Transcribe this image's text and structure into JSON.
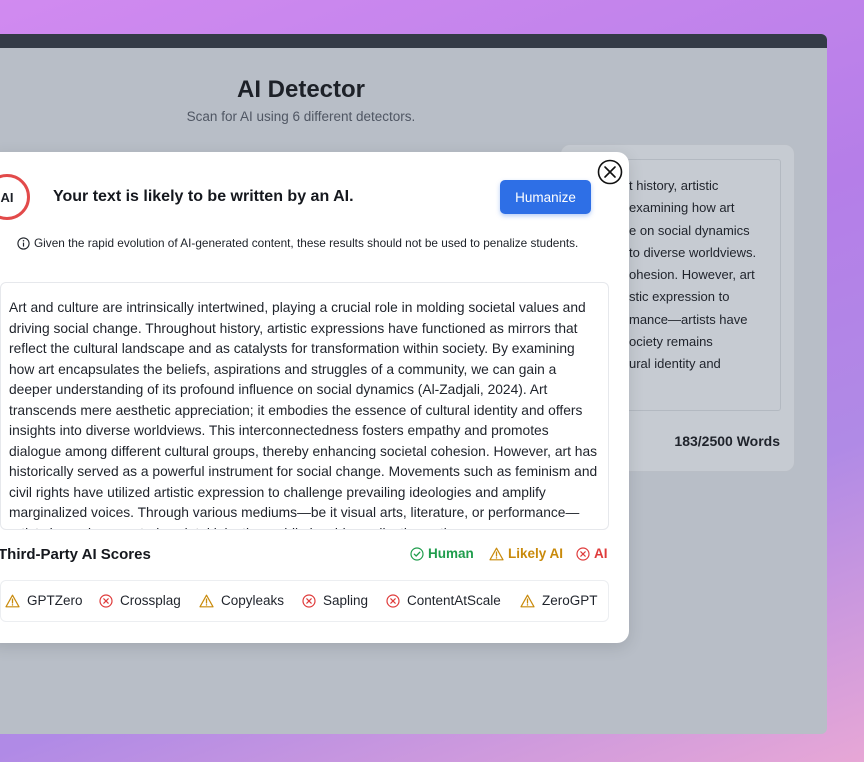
{
  "app": {
    "title": "AI Detector",
    "subtitle": "Scan for AI using 6 different detectors."
  },
  "background_card": {
    "lines": [
      "t history, artistic",
      "examining how art",
      "e on social dynamics",
      "to diverse worldviews.",
      "ohesion. However, art",
      "stic expression to",
      "mance—artists have",
      "ociety remains",
      "ural identity and"
    ],
    "word_count": "183/2500 Words"
  },
  "modal": {
    "badge": "AI",
    "verdict": "Your text is likely to be written by an AI.",
    "humanize_label": "Humanize",
    "disclaimer": "Given the rapid evolution of AI-generated content, these results should not be used to penalize students.",
    "text": "Art and culture are intrinsically intertwined, playing a crucial role in molding societal values and driving social change. Throughout history, artistic expressions have functioned as mirrors that reflect the cultural landscape and as catalysts for transformation within society. By examining how art encapsulates the beliefs, aspirations and struggles of a community, we can gain a deeper understanding of its profound influence on social dynamics (Al-Zadjali, 2024). Art transcends mere aesthetic appreciation; it embodies the essence of cultural identity and offers insights into diverse worldviews. This interconnectedness fosters empathy and promotes dialogue among different cultural groups, thereby enhancing societal cohesion. However, art has historically served as a powerful instrument for social change. Movements such as feminism and civil rights have utilized artistic expression to challenge prevailing ideologies and amplify marginalized voices. Through various mediums—be it visual arts, literature, or performance—artists have documented societal injustices while inspiring collective action.",
    "scores_title": "Third-Party AI Scores",
    "legend": [
      {
        "label": "Human",
        "status": "human",
        "color": "#1f9d4c"
      },
      {
        "label": "Likely AI",
        "status": "likely-ai",
        "color": "#c98a0b"
      },
      {
        "label": "AI",
        "status": "ai",
        "color": "#df3b3b"
      }
    ],
    "detectors": [
      {
        "name": "GPTZero",
        "status": "likely-ai"
      },
      {
        "name": "Crossplag",
        "status": "ai"
      },
      {
        "name": "Copyleaks",
        "status": "likely-ai"
      },
      {
        "name": "Sapling",
        "status": "ai"
      },
      {
        "name": "ContentAtScale",
        "status": "ai"
      },
      {
        "name": "ZeroGPT",
        "status": "likely-ai"
      }
    ]
  }
}
